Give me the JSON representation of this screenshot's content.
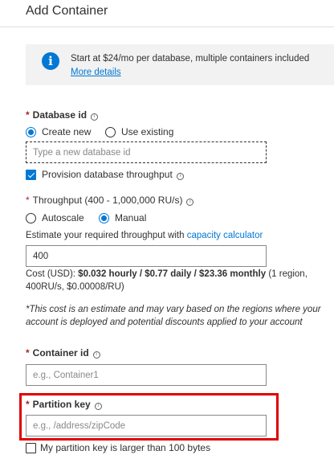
{
  "header": {
    "title": "Add Container"
  },
  "info": {
    "icon": "info-icon",
    "text": "Start at $24/mo per database, multiple containers included",
    "link": "More details"
  },
  "database_id": {
    "required_mark": "*",
    "label": "Database id",
    "options": [
      "Create new",
      "Use existing"
    ],
    "selected": "Create new",
    "placeholder": "Type a new database id",
    "value": ""
  },
  "provision_throughput": {
    "label": "Provision database throughput",
    "checked": true
  },
  "throughput": {
    "required_mark": "*",
    "label": "Throughput (400 - 1,000,000 RU/s)",
    "options": [
      "Autoscale",
      "Manual"
    ],
    "selected": "Manual",
    "estimate_text": "Estimate your required throughput with ",
    "estimate_link": "capacity calculator",
    "value": "400"
  },
  "cost": {
    "prefix": "Cost (USD): ",
    "amount": "$0.032 hourly / $0.77 daily / $23.36 monthly",
    "suffix": " (1 region, 400RU/s, $0.00008/RU)"
  },
  "disclaimer": "*This cost is an estimate and may vary based on the regions where your account is deployed and potential discounts applied to your account",
  "container_id": {
    "required_mark": "*",
    "label": "Container id",
    "placeholder": "e.g., Container1",
    "value": ""
  },
  "partition_key": {
    "required_mark": "*",
    "label": "Partition key",
    "placeholder": "e.g., /address/zipCode",
    "value": "",
    "highlight_color": "#e00000"
  },
  "large_partition_key": {
    "label": "My partition key is larger than 100 bytes",
    "checked": false
  },
  "colors": {
    "accent": "#0078d4",
    "required": "#a4262c",
    "info_bg": "#f2f2f2"
  }
}
